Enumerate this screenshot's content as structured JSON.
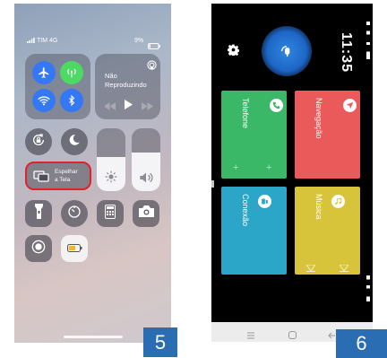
{
  "left_screen": {
    "status": {
      "carrier": "TIM 4G",
      "battery": "9%"
    },
    "media": {
      "title": "Não Reproduzindo"
    },
    "mirror": {
      "label_line1": "Espelhar",
      "label_line2": "a Tela"
    },
    "sliders": {
      "brightness_level": 0.55,
      "volume_level": 0.62
    },
    "icons": [
      "airplane-icon",
      "cellular-icon",
      "wifi-icon",
      "bluetooth-icon",
      "airplay-icon",
      "rewind-icon",
      "play-icon",
      "forward-icon",
      "rotation-lock-icon",
      "moon-icon",
      "screen-mirror-icon",
      "sun-icon",
      "speaker-icon",
      "flashlight-icon",
      "timer-icon",
      "calculator-icon",
      "camera-icon",
      "record-icon",
      "battery-icon"
    ],
    "colors": {
      "airplane": "#3478f6",
      "cellular": "#4cd964",
      "wifi": "#3478f6",
      "bluetooth": "#3478f6",
      "highlight": "#e0212b"
    }
  },
  "right_screen": {
    "time": "11:35",
    "cards": [
      {
        "label": "Telefone",
        "color": "#3bb867",
        "icon": "phone-icon"
      },
      {
        "label": "Navegação",
        "color": "#ea5a5a",
        "icon": "navigation-icon"
      },
      {
        "label": "Conexão",
        "color": "#2ba6c9",
        "icon": "connection-icon"
      },
      {
        "label": "Música",
        "color": "#d8c43a",
        "icon": "music-icon"
      }
    ],
    "nav_icons": [
      "menu-icon",
      "home-icon",
      "back-icon"
    ]
  },
  "badges": {
    "left": "5",
    "right": "6"
  }
}
